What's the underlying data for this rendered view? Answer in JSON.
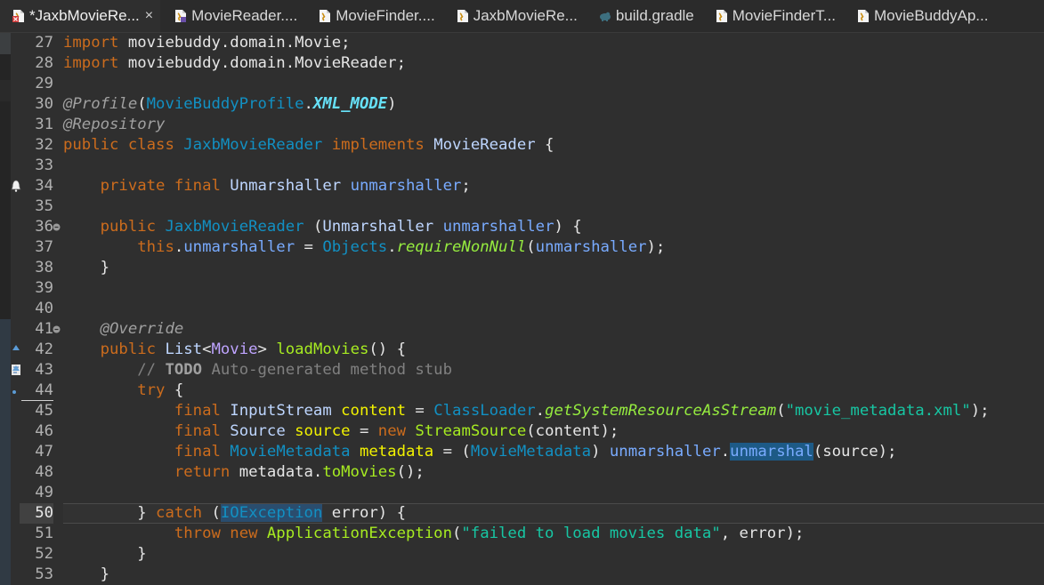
{
  "tabs": [
    {
      "label": "*JaxbMovieRe...",
      "icon": "java-file-error-icon",
      "active": true,
      "closable": true
    },
    {
      "label": "MovieReader....",
      "icon": "java-interface-file-icon",
      "active": false
    },
    {
      "label": "MovieFinder....",
      "icon": "java-class-file-icon",
      "active": false
    },
    {
      "label": "JaxbMovieRe...",
      "icon": "java-class-file-icon",
      "active": false
    },
    {
      "label": "build.gradle",
      "icon": "gradle-file-icon",
      "active": false
    },
    {
      "label": "MovieFinderT...",
      "icon": "java-class-file-icon",
      "active": false
    },
    {
      "label": "MovieBuddyAp...",
      "icon": "java-class-file-icon",
      "active": false
    }
  ],
  "close_glyph": "×",
  "current_line": 50,
  "lines": [
    {
      "n": "27",
      "tokens": [
        [
          "kw",
          "import"
        ],
        [
          "plain",
          " moviebuddy.domain.Movie;"
        ]
      ]
    },
    {
      "n": "28",
      "tokens": [
        [
          "kw",
          "import"
        ],
        [
          "plain",
          " moviebuddy.domain.MovieReader;"
        ]
      ]
    },
    {
      "n": "29",
      "tokens": []
    },
    {
      "n": "30",
      "tokens": [
        [
          "ann",
          "@Profile"
        ],
        [
          "plain",
          "("
        ],
        [
          "ty",
          "MovieBuddyProfile"
        ],
        [
          "plain",
          "."
        ],
        [
          "fld",
          "XML_MODE"
        ],
        [
          "plain",
          ")"
        ]
      ]
    },
    {
      "n": "31",
      "tokens": [
        [
          "ann",
          "@Repository"
        ]
      ]
    },
    {
      "n": "32",
      "tokens": [
        [
          "kw",
          "public class "
        ],
        [
          "ty",
          "JaxbMovieReader"
        ],
        [
          "kw",
          " implements "
        ],
        [
          "gen",
          "MovieReader"
        ],
        [
          "plain",
          " {"
        ]
      ]
    },
    {
      "n": "33",
      "tokens": []
    },
    {
      "n": "34",
      "icon": "warning-icon",
      "tokens": [
        [
          "plain",
          "    "
        ],
        [
          "kw",
          "private final "
        ],
        [
          "gen",
          "Unmarshaller"
        ],
        [
          "plain",
          " "
        ],
        [
          "var",
          "unmarshaller"
        ],
        [
          "plain",
          ";"
        ]
      ]
    },
    {
      "n": "35",
      "tokens": []
    },
    {
      "n": "36",
      "fold": true,
      "tokens": [
        [
          "plain",
          "    "
        ],
        [
          "kw",
          "public "
        ],
        [
          "ty",
          "JaxbMovieReader"
        ],
        [
          "plain",
          " ("
        ],
        [
          "gen",
          "Unmarshaller"
        ],
        [
          "plain",
          " "
        ],
        [
          "var",
          "unmarshaller"
        ],
        [
          "plain",
          ") {"
        ]
      ]
    },
    {
      "n": "37",
      "tokens": [
        [
          "plain",
          "        "
        ],
        [
          "kw",
          "this"
        ],
        [
          "plain",
          "."
        ],
        [
          "var",
          "unmarshaller"
        ],
        [
          "plain",
          " = "
        ],
        [
          "cls",
          "Objects"
        ],
        [
          "plain",
          "."
        ],
        [
          "smth",
          "requireNonNull"
        ],
        [
          "plain",
          "("
        ],
        [
          "var",
          "unmarshaller"
        ],
        [
          "plain",
          ");"
        ]
      ]
    },
    {
      "n": "38",
      "tokens": [
        [
          "plain",
          "    }"
        ]
      ]
    },
    {
      "n": "39",
      "tokens": []
    },
    {
      "n": "40",
      "tokens": []
    },
    {
      "n": "41",
      "fold": true,
      "tokens": [
        [
          "plain",
          "    "
        ],
        [
          "ann",
          "@Override"
        ]
      ]
    },
    {
      "n": "42",
      "icon": "override-arrow-icon",
      "tokens": [
        [
          "plain",
          "    "
        ],
        [
          "kw",
          "public "
        ],
        [
          "gen",
          "List"
        ],
        [
          "plain",
          "<"
        ],
        [
          "tpar",
          "Movie"
        ],
        [
          "plain",
          "> "
        ],
        [
          "mth",
          "loadMovies"
        ],
        [
          "plain",
          "() {"
        ]
      ]
    },
    {
      "n": "43",
      "icon": "task-todo-icon",
      "tokens": [
        [
          "plain",
          "        "
        ],
        [
          "cmt",
          "// "
        ],
        [
          "todo",
          "TODO"
        ],
        [
          "cmt",
          " Auto-generated method stub"
        ]
      ]
    },
    {
      "n": "44",
      "icon": "bookmark-dot-icon",
      "underline": true,
      "tokens": [
        [
          "plain",
          "        "
        ],
        [
          "kw",
          "try"
        ],
        [
          "plain",
          " {"
        ]
      ]
    },
    {
      "n": "45",
      "tokens": [
        [
          "plain",
          "            "
        ],
        [
          "kw",
          "final "
        ],
        [
          "gen",
          "InputStream"
        ],
        [
          "plain",
          " "
        ],
        [
          "loc",
          "content"
        ],
        [
          "plain",
          " = "
        ],
        [
          "ty",
          "ClassLoader"
        ],
        [
          "plain",
          "."
        ],
        [
          "smth",
          "getSystemResourceAsStream"
        ],
        [
          "plain",
          "("
        ],
        [
          "str",
          "\"movie_metadata.xml\""
        ],
        [
          "plain",
          ");"
        ]
      ]
    },
    {
      "n": "46",
      "tokens": [
        [
          "plain",
          "            "
        ],
        [
          "kw",
          "final "
        ],
        [
          "gen",
          "Source"
        ],
        [
          "plain",
          " "
        ],
        [
          "loc",
          "source"
        ],
        [
          "plain",
          " = "
        ],
        [
          "kw",
          "new "
        ],
        [
          "mth",
          "StreamSource"
        ],
        [
          "plain",
          "(content);"
        ]
      ]
    },
    {
      "n": "47",
      "tokens": [
        [
          "plain",
          "            "
        ],
        [
          "kw",
          "final "
        ],
        [
          "ty",
          "MovieMetadata"
        ],
        [
          "plain",
          " "
        ],
        [
          "loc",
          "metadata"
        ],
        [
          "plain",
          " = ("
        ],
        [
          "ty",
          "MovieMetadata"
        ],
        [
          "plain",
          ") "
        ],
        [
          "var",
          "unmarshaller"
        ],
        [
          "plain",
          "."
        ],
        [
          "hl-sel|var",
          "unmarshal"
        ],
        [
          "plain",
          "(source);"
        ]
      ]
    },
    {
      "n": "48",
      "tokens": [
        [
          "plain",
          "            "
        ],
        [
          "kw",
          "return "
        ],
        [
          "plain",
          "metadata."
        ],
        [
          "mth",
          "toMovies"
        ],
        [
          "plain",
          "();"
        ]
      ]
    },
    {
      "n": "49",
      "tokens": []
    },
    {
      "n": "50",
      "current": true,
      "tokens": [
        [
          "plain",
          "        } "
        ],
        [
          "kw",
          "catch"
        ],
        [
          "plain",
          " ("
        ],
        [
          "hl-occ|ty",
          "IOException"
        ],
        [
          "plain",
          " error) {"
        ]
      ]
    },
    {
      "n": "51",
      "tokens": [
        [
          "plain",
          "            "
        ],
        [
          "kw",
          "throw new "
        ],
        [
          "mth",
          "ApplicationException"
        ],
        [
          "plain",
          "("
        ],
        [
          "str",
          "\"failed to load movies data\""
        ],
        [
          "plain",
          ", error);"
        ]
      ]
    },
    {
      "n": "52",
      "tokens": [
        [
          "plain",
          "        }"
        ]
      ]
    },
    {
      "n": "53",
      "tokens": [
        [
          "plain",
          "    }"
        ]
      ]
    }
  ],
  "colors": {
    "editor_bg": "#2f2f2f",
    "keyword": "#cc6c1d",
    "type": "#1290c3",
    "method": "#a7ec21",
    "string": "#17c6a3",
    "field": "#66e1f8",
    "local": "#f2f200"
  }
}
